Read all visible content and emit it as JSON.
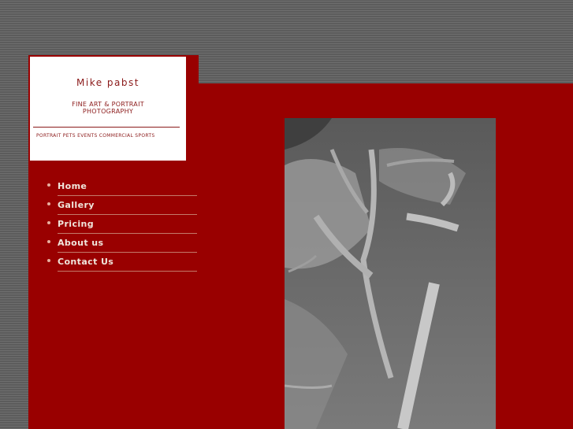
{
  "logo": {
    "title": "Mike pabst",
    "subtitle_line1": "FINE ART & PORTRAIT",
    "subtitle_line2": "PHOTOGRAPHY",
    "categories": "PORTRAIT  PETS  EVENTS  COMMERCIAL  SPORTS"
  },
  "nav": {
    "items": [
      {
        "label": "Home"
      },
      {
        "label": "Gallery"
      },
      {
        "label": "Pricing"
      },
      {
        "label": "About us"
      },
      {
        "label": "Contact Us"
      }
    ]
  },
  "colors": {
    "background_red": "#990000",
    "logo_text": "#8b1a1a",
    "nav_text": "#f0e6dc"
  },
  "photo": {
    "subject": "black and white photo of tree roots on rocky ground"
  }
}
